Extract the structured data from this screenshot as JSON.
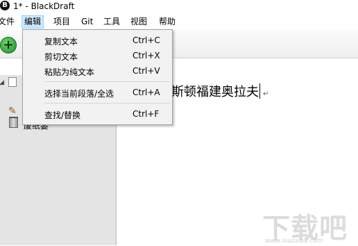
{
  "titlebar": {
    "app_icon": "B",
    "title": "1* - BlackDraft"
  },
  "menubar": {
    "items": [
      {
        "label": "文件"
      },
      {
        "label": "编辑"
      },
      {
        "label": "项目"
      },
      {
        "label": "Git"
      },
      {
        "label": "工具"
      },
      {
        "label": "视图"
      },
      {
        "label": "帮助"
      }
    ],
    "active": "编辑"
  },
  "toolbar": {
    "add_icon": "+"
  },
  "sidebar": {
    "trash_label": "废纸篓"
  },
  "editor": {
    "text": "斯顿福建奥拉夫",
    "paragraph_mark": "↵"
  },
  "edit_menu": {
    "items": [
      {
        "label": "复制文本",
        "shortcut": "Ctrl+C"
      },
      {
        "label": "剪切文本",
        "shortcut": "Ctrl+X"
      },
      {
        "label": "粘贴为纯文本",
        "shortcut": "Ctrl+V"
      },
      {
        "label": "选择当前段落/全选",
        "shortcut": "Ctrl+A"
      },
      {
        "label": "查找/替换",
        "shortcut": "Ctrl+F"
      }
    ]
  },
  "watermark": {
    "big": "下载吧",
    "small": "www.xiazaiba.com"
  },
  "colors": {
    "menu_highlight": "#cce8ff",
    "sidebar_bg": "#e4e4e4",
    "add_button": "#2e9e3a"
  }
}
